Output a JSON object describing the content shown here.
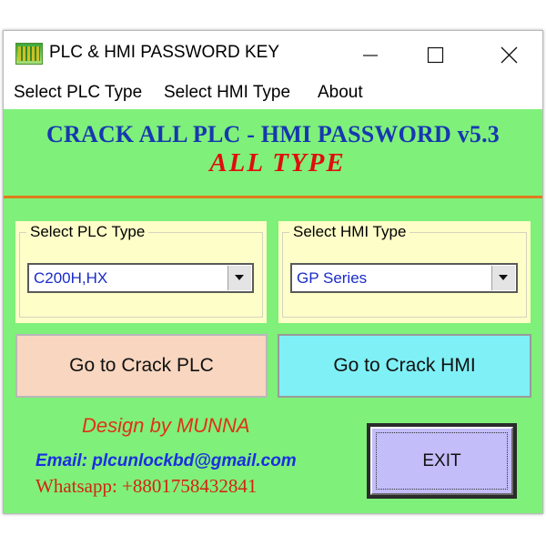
{
  "window": {
    "title": "PLC & HMI PASSWORD KEY",
    "app_icon": "plc-app-icon",
    "controls": [
      "minimize-icon",
      "maximize-icon",
      "close-icon"
    ]
  },
  "menu": {
    "items": [
      {
        "label": "Select PLC Type"
      },
      {
        "label": "Select HMI Type"
      },
      {
        "label": "About"
      }
    ]
  },
  "header": {
    "headline": "CRACK ALL PLC - HMI PASSWORD v5.3",
    "subhead": "ALL  TYPE"
  },
  "plc_group": {
    "legend": "Select PLC Type",
    "selected": "C200H,HX"
  },
  "hmi_group": {
    "legend": "Select HMI Type",
    "selected": "GP Series"
  },
  "buttons": {
    "crack_plc": "Go to Crack PLC",
    "crack_hmi": "Go to Crack HMI",
    "exit": "EXIT"
  },
  "credits": {
    "design": "Design by MUNNA",
    "email": "Email: plcunlockbd@gmail.com",
    "whatsapp": "Whatsapp: +8801758432841"
  },
  "colors": {
    "window_bg": "#7ff07a",
    "headline": "#1638b0",
    "subhead": "#e00d0d",
    "divider": "#e07b1c",
    "group_bg": "#fdfec8",
    "plc_button": "#f8d6bf",
    "hmi_button": "#7ff0f6",
    "exit_button": "#c3bdf9"
  }
}
